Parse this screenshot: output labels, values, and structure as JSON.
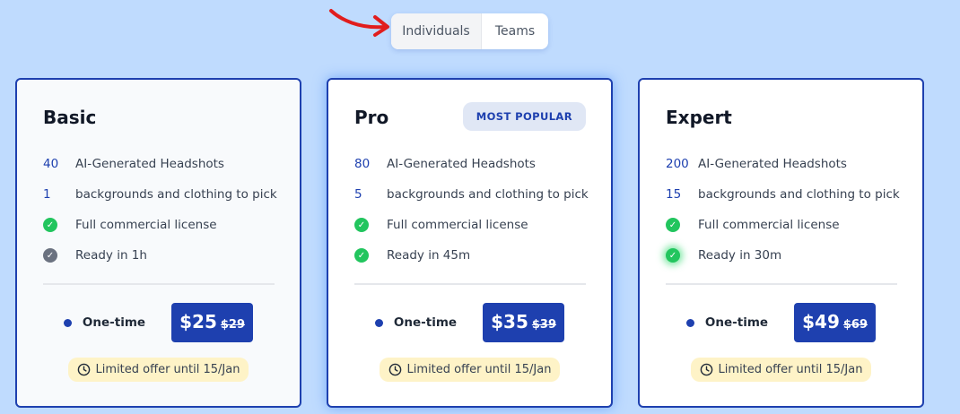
{
  "toggle": {
    "active": "Individuals",
    "inactive": "Teams"
  },
  "plans": [
    {
      "name": "Basic",
      "headshots_count": "40",
      "headshots_label": "AI-Generated Headshots",
      "bg_count": "1",
      "bg_label": "backgrounds and clothing to pick",
      "license": "Full commercial license",
      "ready": "Ready in 1h",
      "pay_label": "One-time",
      "price": "$25",
      "old_price": "$29",
      "offer": "Limited offer until 15/Jan"
    },
    {
      "name": "Pro",
      "badge": "MOST POPULAR",
      "headshots_count": "80",
      "headshots_label": "AI-Generated Headshots",
      "bg_count": "5",
      "bg_label": "backgrounds and clothing to pick",
      "license": "Full commercial license",
      "ready": "Ready in 45m",
      "pay_label": "One-time",
      "price": "$35",
      "old_price": "$39",
      "offer": "Limited offer until 15/Jan"
    },
    {
      "name": "Expert",
      "headshots_count": "200",
      "headshots_label": "AI-Generated Headshots",
      "bg_count": "15",
      "bg_label": "backgrounds and clothing to pick",
      "license": "Full commercial license",
      "ready": "Ready in 30m",
      "pay_label": "One-time",
      "price": "$49",
      "old_price": "$69",
      "offer": "Limited offer until 15/Jan"
    }
  ],
  "colors": {
    "page_bg": "#bfdbfe",
    "accent": "#1e40af",
    "check_green": "#22c55e",
    "check_gray": "#6b7280",
    "offer_bg": "#fef3c7",
    "arrow": "#e11d1d"
  }
}
